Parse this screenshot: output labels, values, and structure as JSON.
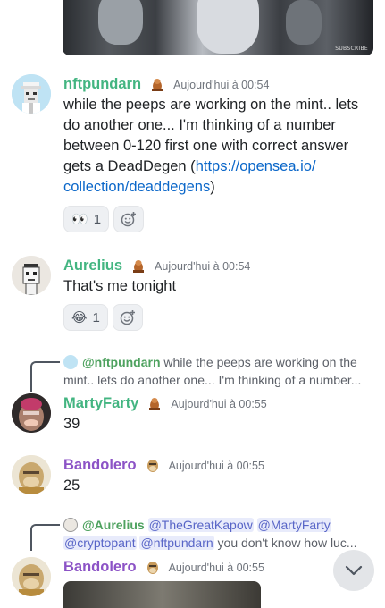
{
  "top_media": {
    "watermark": "SUBSCRIBE"
  },
  "messages": [
    {
      "author": "nftpundarn",
      "author_color": "#43b581",
      "timestamp": "Aujourd'hui à 00:54",
      "lines": [
        "while the peeps are working on the mint.. lets",
        "do another one... I'm thinking of a number",
        "between 0-120 first one with correct answer",
        "gets a DeadDegen ("
      ],
      "link_part1": "https://opensea.io/",
      "link_part2": "collection/deaddegens",
      "link_close": ")",
      "reactions": [
        {
          "emoji": "👀",
          "count": "1",
          "icon": "eyes-emoji"
        }
      ]
    },
    {
      "author": "Aurelius",
      "author_color": "#43b581",
      "timestamp": "Aujourd'hui à 00:54",
      "text": "That's me tonight",
      "reactions": [
        {
          "emoji": "😂",
          "count": "1",
          "icon": "joy-emoji"
        }
      ]
    },
    {
      "reply_to": {
        "author": "@nftpundarn",
        "line1": " while the peeps are working on the",
        "line2": "mint.. lets do another one... I'm thinking of a number..."
      },
      "author": "MartyFarty",
      "author_color": "#43b581",
      "timestamp": "Aujourd'hui à 00:55",
      "text": "39"
    },
    {
      "author": "Bandolero",
      "author_color": "#8c53c6",
      "timestamp": "Aujourd'hui à 00:55",
      "text": "25"
    },
    {
      "reply_to": {
        "author": "@Aurelius",
        "mention1": "@TheGreatKapow",
        "mention2": "@MartyFarty",
        "mention3": "@cryptopant",
        "mention4": "@nftpundarn",
        "tail": " you don't know how luc..."
      },
      "author": "Bandolero",
      "author_color": "#8c53c6",
      "timestamp": "Aujourd'hui à 00:55"
    }
  ],
  "scroll_button": {
    "icon": "chevron-down-icon"
  }
}
